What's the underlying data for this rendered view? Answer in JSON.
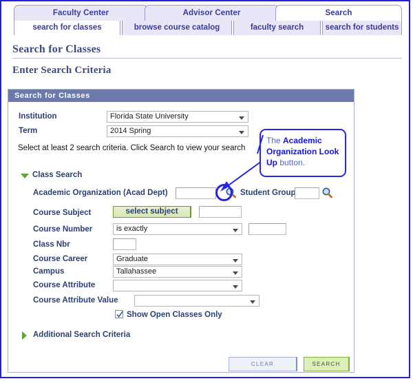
{
  "tabs": {
    "primary": [
      {
        "label": "Faculty Center",
        "active": false
      },
      {
        "label": "Advisor Center",
        "active": false
      },
      {
        "label": "Search",
        "active": true
      }
    ],
    "secondary": [
      {
        "label": "search for classes",
        "active": true
      },
      {
        "label": "browse course catalog",
        "active": false
      },
      {
        "label": "faculty search",
        "active": false
      },
      {
        "label": "search for students",
        "active": false
      }
    ]
  },
  "headings": {
    "page_title": "Search for Classes",
    "section_title": "Enter Search Criteria"
  },
  "panel": {
    "header": "Search for Classes",
    "institution_label": "Institution",
    "institution_value": "Florida State University",
    "term_label": "Term",
    "term_value": "2014 Spring",
    "instruction": "Select at least 2 search criteria. Click Search to view your search",
    "class_search_label": "Class Search",
    "acad_org_label": "Academic Organization (Acad Dept)",
    "acad_org_value": "",
    "student_group_label": "Student Group",
    "student_group_value": "",
    "course_subject_label": "Course Subject",
    "select_subject_button": "select subject",
    "course_subject_value": "",
    "course_number_label": "Course Number",
    "course_number_operator": "is exactly",
    "course_number_value": "",
    "class_nbr_label": "Class Nbr",
    "class_nbr_value": "",
    "course_career_label": "Course Career",
    "course_career_value": "Graduate",
    "campus_label": "Campus",
    "campus_value": "Tallahassee",
    "course_attribute_label": "Course Attribute",
    "course_attribute_value": "",
    "course_attribute_value_label": "Course Attribute Value",
    "course_attribute_value_value": "",
    "show_open_label": "Show Open Classes Only",
    "show_open_checked": true,
    "additional_criteria_label": "Additional Search Criteria",
    "clear_button": "Clear",
    "search_button": "Search"
  },
  "callout": {
    "text_before": "The ",
    "bold1": "Academic Organization Look Up",
    "text_after": " button."
  },
  "colors": {
    "frame_blue": "#2020e0",
    "panel_header": "#6b7aab",
    "tab_bg": "#e9e6f7",
    "label_blue": "#2b4173",
    "heading_blue": "#3d4a80",
    "green_button": "#ddeebb",
    "callout_blue": "#2424e6",
    "triangle_green": "#5aa832"
  }
}
